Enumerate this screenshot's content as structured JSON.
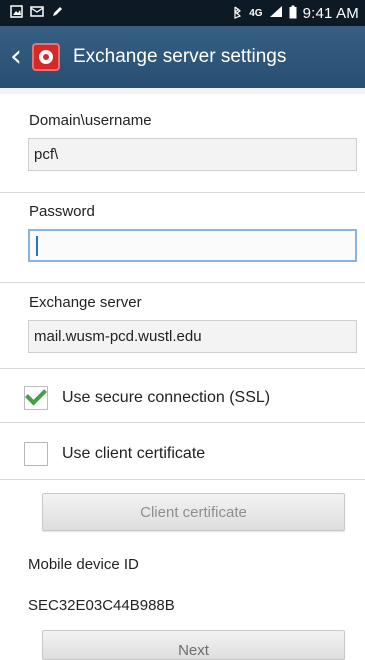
{
  "status_bar": {
    "time": "9:41 AM",
    "network": "4G",
    "icons": [
      "gallery-icon",
      "message-icon",
      "edit-icon",
      "bluetooth-icon",
      "signal-icon",
      "battery-icon"
    ]
  },
  "header": {
    "title": "Exchange server settings",
    "back_icon": "back-arrow-icon",
    "app_icon": "exchange-app-icon",
    "background": "#2f5679"
  },
  "form": {
    "domain_username": {
      "label": "Domain\\username",
      "value": "pcf\\"
    },
    "password": {
      "label": "Password",
      "value": ""
    },
    "exchange_server": {
      "label": "Exchange server",
      "value": "mail.wusm-pcd.wustl.edu"
    },
    "ssl": {
      "label": "Use secure connection (SSL)",
      "checked": true
    },
    "client_certificate": {
      "label": "Use client certificate",
      "checked": false
    },
    "client_certificate_button": "Client certificate",
    "mobile_device_id_label": "Mobile device ID",
    "mobile_device_id": "SEC32E03C44B988B",
    "next_button": "Next"
  },
  "colors": {
    "status_bar": "#0d1a25",
    "header": "#2f5679",
    "checkbox_check": "#43a047",
    "focus_border": "#8ab4e2"
  }
}
